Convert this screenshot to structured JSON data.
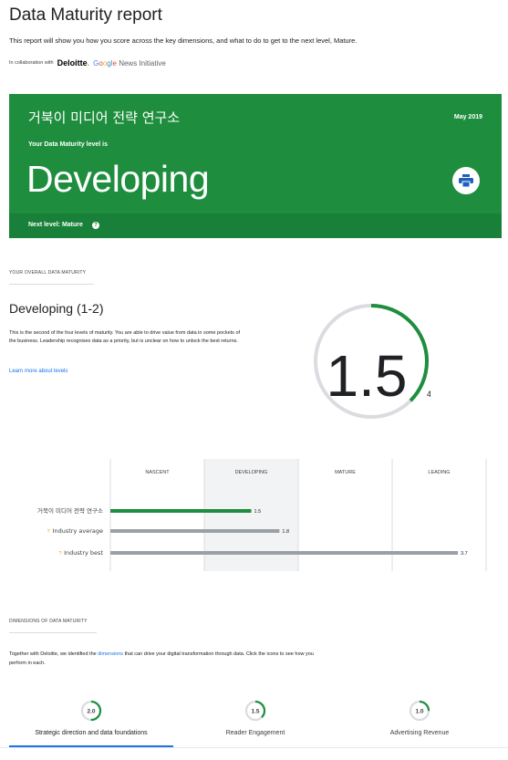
{
  "header": {
    "title": "Data Maturity report",
    "subtitle": "This report will show you how you score across the key dimensions, and what to do to get to the next level, Mature.",
    "collab_prefix": "In collaboration with",
    "partner_1": "Deloitte",
    "partner_2": "Google News Initiative"
  },
  "card": {
    "org_name": "거북이 미디어 전략 연구소",
    "date": "May 2019",
    "level_label": "Your Data Maturity level is",
    "level": "Developing",
    "next_level": "Next level: Mature",
    "help_icon": "?",
    "print_icon": "printer-icon"
  },
  "overall": {
    "section_label": "YOUR OVERALL DATA MATURITY",
    "title": "Developing (1-2)",
    "description": "This is the second of the four levels of maturity. You are able to drive value from data in some pockets of the business. Leadership recognises data as a priority, but is unclear on how to unlock the best returns.",
    "learn_more": "Learn more about levels",
    "score": "1.5",
    "score_max": "4",
    "score_value": 1.5,
    "score_total": 4
  },
  "chart_data": {
    "type": "bar",
    "orientation": "horizontal",
    "levels": [
      "NASCENT",
      "DEVELOPING",
      "MATURE",
      "LEADING"
    ],
    "highlighted_level": "DEVELOPING",
    "xlim": [
      0,
      4
    ],
    "categories": [
      "거북이 미디어 전략 연구소",
      "Industry average",
      "Industry best"
    ],
    "values": [
      1.5,
      1.8,
      3.7
    ],
    "value_labels": [
      "1.5",
      "1.8",
      "3.7"
    ],
    "help_marks": [
      "",
      "?",
      "?"
    ],
    "colors": [
      "#1e8e3e",
      "#9aa0a6",
      "#9aa0a6"
    ]
  },
  "dimensions": {
    "section_label": "DIMENSIONS OF DATA MATURITY",
    "desc_before": "Together with Deloitte, we identified the ",
    "desc_link": "dimensions",
    "desc_after": " that can drive your digital transformation through data. Click the icons to see how you perform in each.",
    "items": [
      {
        "label": "Strategic direction and data foundations",
        "score": "2.0",
        "value": 2.0,
        "active": true
      },
      {
        "label": "Reader Engagement",
        "score": "1.5",
        "value": 1.5,
        "active": false
      },
      {
        "label": "Advertising Revenue",
        "score": "1.0",
        "value": 1.0,
        "active": false
      }
    ]
  },
  "colors": {
    "accent_green": "#1e8e3e",
    "dark_green": "#188038",
    "link_blue": "#1a73e8",
    "bar_grey": "#9aa0a6"
  }
}
